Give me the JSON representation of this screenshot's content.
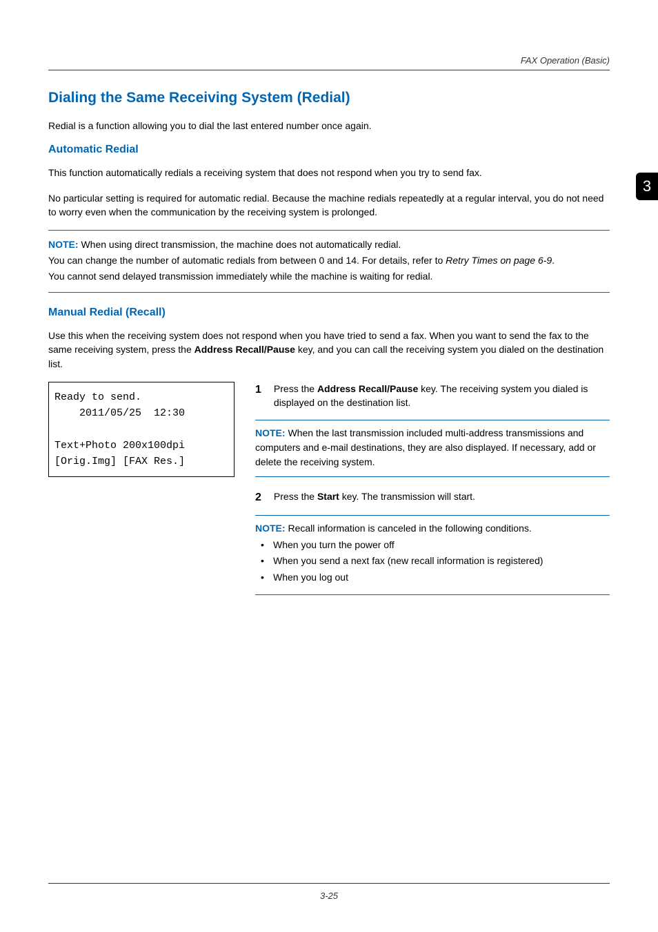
{
  "header": {
    "section": "FAX Operation (Basic)"
  },
  "chapter_tab": "3",
  "h1": "Dialing the Same Receiving System (Redial)",
  "intro": "Redial is a function allowing you to dial the last entered number once again.",
  "auto": {
    "title": "Automatic Redial",
    "p1": "This function automatically redials a receiving system that does not respond when you try to send fax.",
    "p2": "No particular setting is required for automatic redial. Because the machine redials repeatedly at a regular interval, you do not need to worry even when the communication by the receiving system is prolonged."
  },
  "note1": {
    "label": "NOTE:",
    "lines": {
      "l1": " When using direct transmission, the machine does not automatically redial.",
      "l2a": "You can change the number of automatic redials from between 0 and 14. For details, refer to ",
      "l2b": "Retry Times on page 6-9",
      "l2c": ".",
      "l3": "You cannot send delayed transmission immediately while the machine is waiting for redial."
    }
  },
  "manual": {
    "title": "Manual Redial (Recall)",
    "p1a": "Use this when the receiving system does not respond when you have tried to send a fax. When you want to send the fax to the same receiving system, press the ",
    "p1b": "Address Recall/Pause",
    "p1c": " key, and you can call the receiving system you dialed on the destination list."
  },
  "lcd": {
    "line1": "Ready to send.",
    "line2": "    2011/05/25  12:30",
    "line3": "",
    "line4": "Text+Photo 200x100dpi",
    "line5": "[Orig.Img] [FAX Res.]"
  },
  "steps": {
    "s1": {
      "num": "1",
      "a": "Press the ",
      "b": "Address Recall/Pause",
      "c": " key. The receiving system you dialed is displayed on the destination list."
    },
    "s2": {
      "num": "2",
      "a": "Press the ",
      "b": "Start",
      "c": " key. The transmission will start."
    }
  },
  "note2": {
    "label": "NOTE:",
    "text": " When the last transmission included multi-address transmissions and computers and e-mail destinations, they are also displayed. If necessary, add or delete the receiving system."
  },
  "note3": {
    "label": "NOTE:",
    "text": " Recall information is canceled in the following conditions.",
    "bullets": {
      "b1": "When you turn the power off",
      "b2": "When you send a next fax (new recall information is registered)",
      "b3": "When you log out"
    }
  },
  "footer": "3-25"
}
